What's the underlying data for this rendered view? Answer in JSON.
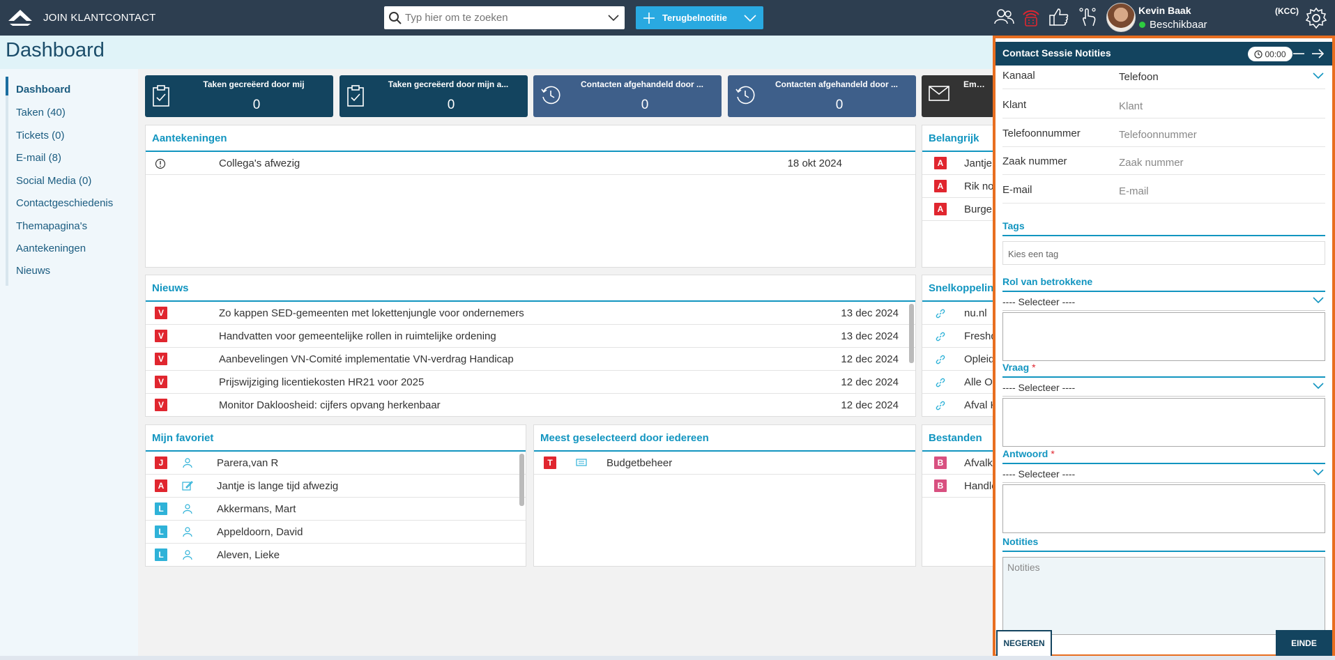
{
  "app": {
    "title": "JOIN KLANTCONTACT"
  },
  "search": {
    "placeholder": "Typ hier om te zoeken"
  },
  "topbar": {
    "action_label": "Terugbelnotitie",
    "user_name": "Kevin Baak",
    "user_status": "Beschikbaar",
    "role": "(KCC)"
  },
  "page": {
    "title": "Dashboard"
  },
  "sidebar": {
    "items": [
      {
        "label": "Dashboard"
      },
      {
        "label": "Taken (40)"
      },
      {
        "label": "Tickets (0)"
      },
      {
        "label": "E-mail (8)"
      },
      {
        "label": "Social Media (0)"
      },
      {
        "label": "Contactgeschiedenis"
      },
      {
        "label": "Themapagina's"
      },
      {
        "label": "Aantekeningen"
      },
      {
        "label": "Nieuws"
      }
    ]
  },
  "tiles": [
    {
      "title": "Taken gecreëerd door mij",
      "value": "0"
    },
    {
      "title": "Taken gecreëerd door mijn a...",
      "value": "0"
    },
    {
      "title": "Contacten afgehandeld door ...",
      "value": "0"
    },
    {
      "title": "Contacten afgehandeld door ...",
      "value": "0"
    },
    {
      "title": "Emails",
      "value": ""
    }
  ],
  "aantekeningen": {
    "title": "Aantekeningen",
    "rows": [
      {
        "text": "Collega's afwezig",
        "date": "18 okt 2024"
      }
    ]
  },
  "belangrijk": {
    "title": "Belangrijk",
    "rows": [
      {
        "badge": "A",
        "text": "Jantje is"
      },
      {
        "badge": "A",
        "text": "Rik nobi"
      },
      {
        "badge": "A",
        "text": "Burgem"
      }
    ]
  },
  "nieuws": {
    "title": "Nieuws",
    "rows": [
      {
        "badge": "V",
        "text": "Zo kappen SED-gemeenten met lokettenjungle voor ondernemers",
        "date": "13 dec 2024"
      },
      {
        "badge": "V",
        "text": "Handvatten voor gemeentelijke rollen in ruimtelijke ordening",
        "date": "13 dec 2024"
      },
      {
        "badge": "V",
        "text": "Aanbevelingen VN-Comité implementatie VN-verdrag Handicap",
        "date": "12 dec 2024"
      },
      {
        "badge": "V",
        "text": "Prijswijziging licentiekosten HR21 voor 2025",
        "date": "12 dec 2024"
      },
      {
        "badge": "V",
        "text": "Monitor Dakloosheid: cijfers opvang herkenbaar",
        "date": "12 dec 2024"
      }
    ]
  },
  "snelkoppelingen": {
    "title": "Snelkoppelinge",
    "rows": [
      {
        "text": "nu.nl"
      },
      {
        "text": "Freshde"
      },
      {
        "text": "Opleidin"
      },
      {
        "text": "Alle Opl"
      },
      {
        "text": "Afval Ka"
      }
    ]
  },
  "favoriet": {
    "title": "Mijn favoriet",
    "rows": [
      {
        "badge": "J",
        "text": "Parera,van R"
      },
      {
        "badge": "A",
        "text": "Jantje is lange tijd afwezig"
      },
      {
        "badge": "L",
        "text": "Akkermans, Mart"
      },
      {
        "badge": "L",
        "text": "Appeldoorn, David"
      },
      {
        "badge": "L",
        "text": "Aleven, Lieke"
      }
    ]
  },
  "meest": {
    "title": "Meest geselecteerd door iedereen",
    "rows": [
      {
        "badge": "T",
        "text": "Budgetbeheer"
      }
    ]
  },
  "bestanden": {
    "title": "Bestanden",
    "rows": [
      {
        "badge": "B",
        "text": "Afvalkal"
      },
      {
        "badge": "B",
        "text": "Handlei"
      }
    ]
  },
  "session": {
    "title": "Contact Sessie Notities",
    "timer": "00:00",
    "fields": [
      {
        "label": "Kanaal",
        "value": "Telefoon"
      },
      {
        "label": "Klant",
        "placeholder": "Klant"
      },
      {
        "label": "Telefoonnummer",
        "placeholder": "Telefoonnummer"
      },
      {
        "label": "Zaak nummer",
        "placeholder": "Zaak nummer"
      },
      {
        "label": "E-mail",
        "placeholder": "E-mail"
      }
    ],
    "tags_title": "Tags",
    "tags_placeholder": "Kies een tag",
    "rol_title": "Rol van betrokkene",
    "vraag_title": "Vraag",
    "antwoord_title": "Antwoord",
    "required_mark": "*",
    "select_placeholder": "---- Selecteer ----",
    "notities_title": "Notities",
    "notities_placeholder": "Notities",
    "negeren_label": "NEGEREN",
    "einde_label": "EINDE"
  }
}
